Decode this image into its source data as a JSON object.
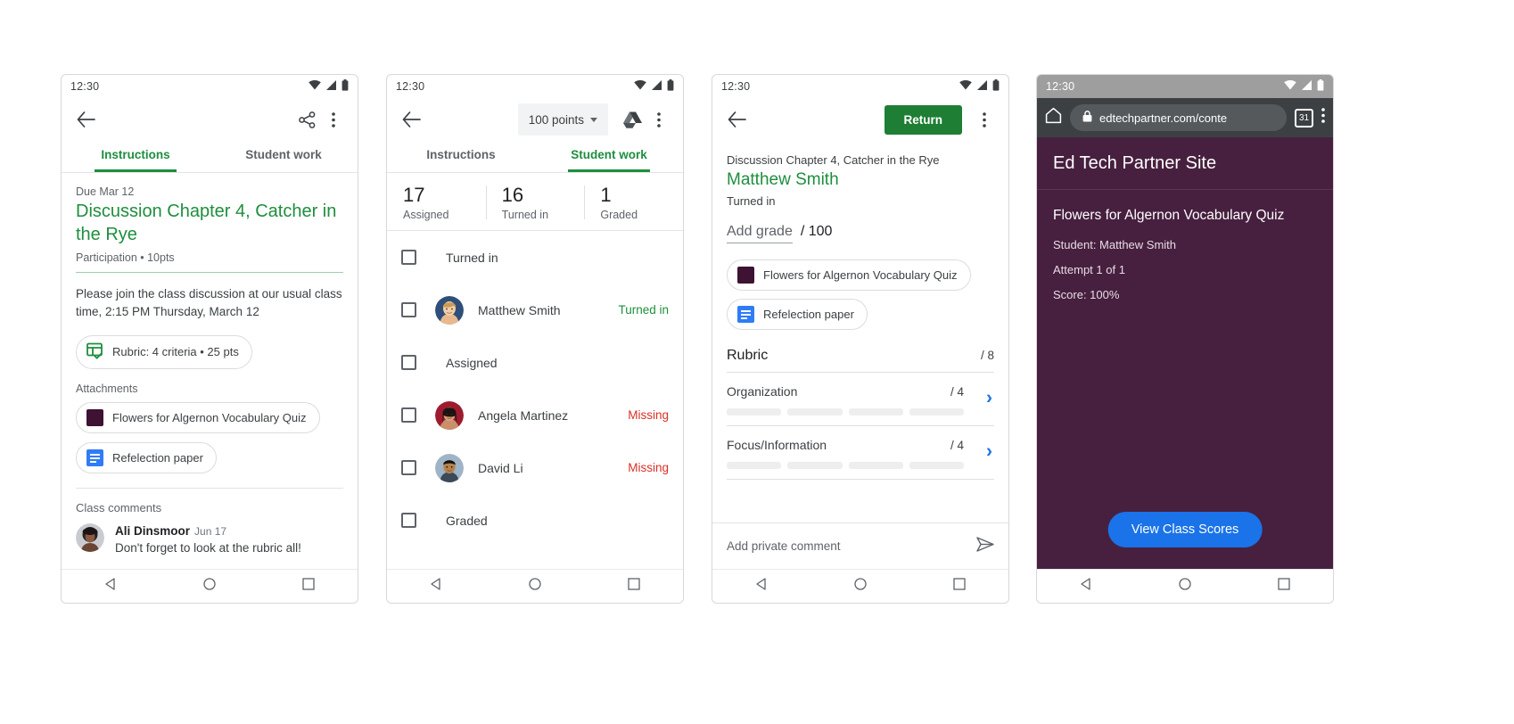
{
  "status": {
    "time": "12:30"
  },
  "phone1": {
    "tabs": [
      {
        "label": "Instructions",
        "active": true
      },
      {
        "label": "Student work",
        "active": false
      }
    ],
    "due": "Due Mar 12",
    "title": "Discussion Chapter 4, Catcher in the Rye",
    "meta": "Participation • 10pts",
    "description": "Please join the class discussion at our usual class time, 2:15 PM Thursday, March 12",
    "rubric_chip": "Rubric: 4 criteria • 25 pts",
    "attachments_label": "Attachments",
    "attachments": [
      {
        "label": "Flowers for Algernon Vocabulary Quiz",
        "icon": "purple-square-icon"
      },
      {
        "label": "Refelection paper",
        "icon": "google-doc-icon"
      }
    ],
    "comments_title": "Class comments",
    "comment": {
      "author": "Ali Dinsmoor",
      "date": "Jun 17",
      "text": "Don't forget to look at the rubric all!"
    }
  },
  "phone2": {
    "points_label": "100 points",
    "tabs": [
      {
        "label": "Instructions",
        "active": false
      },
      {
        "label": "Student work",
        "active": true
      }
    ],
    "stats": [
      {
        "value": "17",
        "label": "Assigned"
      },
      {
        "value": "16",
        "label": "Turned in"
      },
      {
        "value": "1",
        "label": "Graded"
      }
    ],
    "rows": [
      {
        "type": "group",
        "label": "Turned in"
      },
      {
        "type": "student",
        "name": "Matthew Smith",
        "status": "Turned in",
        "statusType": "turnedin",
        "avatar": "matthew"
      },
      {
        "type": "group",
        "label": "Assigned"
      },
      {
        "type": "student",
        "name": "Angela Martinez",
        "status": "Missing",
        "statusType": "missing",
        "avatar": "angela"
      },
      {
        "type": "student",
        "name": "David Li",
        "status": "Missing",
        "statusType": "missing",
        "avatar": "david"
      },
      {
        "type": "group",
        "label": "Graded"
      }
    ]
  },
  "phone3": {
    "return_label": "Return",
    "assignment": "Discussion Chapter 4, Catcher in the Rye",
    "student": "Matthew Smith",
    "state": "Turned in",
    "grade_placeholder": "Add grade",
    "grade_total": "/ 100",
    "attachments": [
      {
        "label": "Flowers for Algernon Vocabulary Quiz",
        "icon": "purple-square-icon"
      },
      {
        "label": "Refelection paper",
        "icon": "google-doc-icon"
      }
    ],
    "rubric_title": "Rubric",
    "rubric_total": "/ 8",
    "criteria": [
      {
        "name": "Organization",
        "points": "/ 4",
        "levels": 4
      },
      {
        "name": "Focus/Information",
        "points": "/ 4",
        "levels": 4
      }
    ],
    "private_comment_placeholder": "Add private comment"
  },
  "phone4": {
    "url": "edtechpartner.com/conte",
    "tab_count": "31",
    "site_title": "Ed Tech Partner Site",
    "quiz_title": "Flowers for Algernon Vocabulary Quiz",
    "lines": [
      "Student: Matthew Smith",
      "Attempt 1 of 1",
      "Score: 100%"
    ],
    "cta_label": "View Class Scores"
  },
  "colors": {
    "green": "#1e8e3e",
    "red": "#d93025",
    "blue": "#1a73e8",
    "purple": "#47203f",
    "return_green": "#1e7e34"
  }
}
